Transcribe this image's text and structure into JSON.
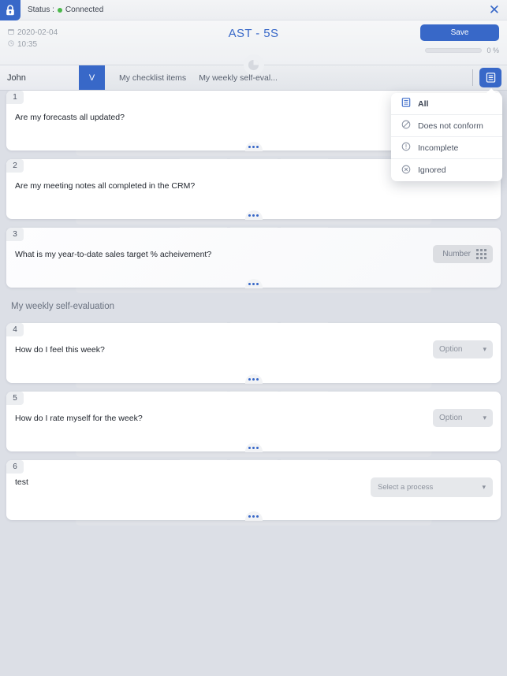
{
  "statusbar": {
    "lock_icon": "lock-icon",
    "status_label": "Status :",
    "connection_state": "Connected",
    "connection_color": "#4ab84a",
    "close_label": "✕"
  },
  "header": {
    "date": "2020-02-04",
    "time": "10:35",
    "date_icon": "calendar-icon",
    "time_icon": "clock-icon",
    "title": "AST - 5S",
    "save_label": "Save",
    "progress_percent": 0,
    "progress_label": "0 %",
    "gauge_icon": "pie-gauge-icon",
    "accent_color": "#3868c8"
  },
  "tabbar": {
    "user_name": "John",
    "validate_badge": "V",
    "tabs": [
      {
        "label": "My checklist items"
      },
      {
        "label": "My weekly self-eval..."
      }
    ],
    "list_button_icon": "list-view-icon"
  },
  "filter_menu": {
    "items": [
      {
        "label": "All",
        "icon": "list-all-icon",
        "active": true
      },
      {
        "label": "Does not conform",
        "icon": "circle-slash-icon",
        "active": false
      },
      {
        "label": "Incomplete",
        "icon": "circle-exclamation-icon",
        "active": false
      },
      {
        "label": "Ignored",
        "icon": "circle-x-icon",
        "active": false
      }
    ]
  },
  "sections": [
    {
      "title": null,
      "questions": [
        {
          "number": "1",
          "text": "Are my forecasts all updated?",
          "control": "none",
          "tinted": false
        },
        {
          "number": "2",
          "text": "Are my meeting notes all completed in the CRM?",
          "control": "none",
          "tinted": false
        },
        {
          "number": "3",
          "text": "What is my year-to-date sales target % acheivement?",
          "control": "number",
          "control_label": "Number",
          "control_icon": "keypad-icon",
          "tinted": true
        }
      ]
    },
    {
      "title": "My weekly self-evaluation",
      "questions": [
        {
          "number": "4",
          "text": "How do I feel this week?",
          "control": "option",
          "control_label": "Option",
          "control_icon": "chevron-down-icon",
          "tinted": false
        },
        {
          "number": "5",
          "text": "How do I rate myself for the week?",
          "control": "option",
          "control_label": "Option",
          "control_icon": "chevron-down-icon",
          "tinted": false
        },
        {
          "number": "6",
          "text": "test",
          "control": "select",
          "control_label": "Select a process",
          "control_icon": "chevron-down-icon",
          "tinted": false,
          "text_high": true
        }
      ]
    }
  ]
}
